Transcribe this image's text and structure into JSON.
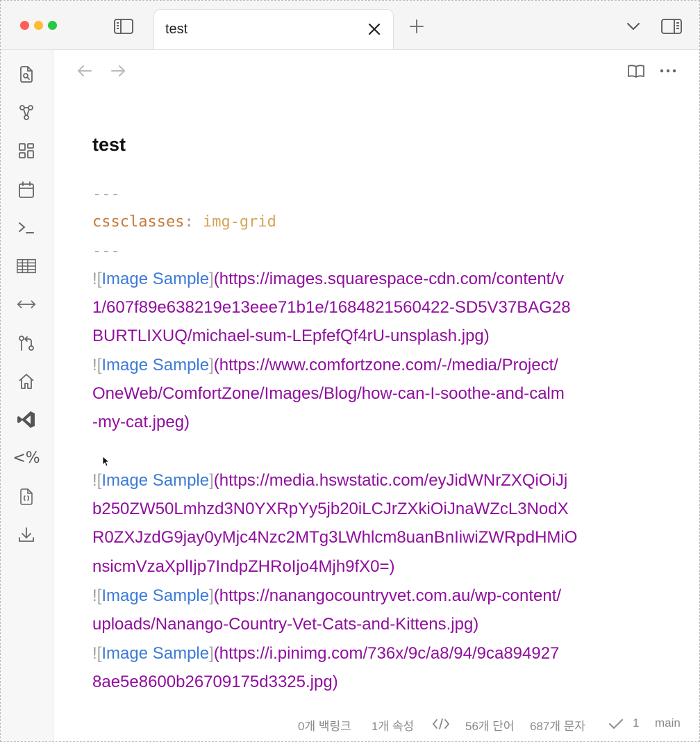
{
  "tab": {
    "title": "test"
  },
  "note": {
    "title": "test",
    "frontmatter": {
      "delimiter": "---",
      "key": "cssclasses",
      "colon": ":",
      "value": "img-grid"
    },
    "embed": {
      "bang": "!",
      "open": "[",
      "alt": "Image Sample",
      "close": "]"
    },
    "lines": [
      {
        "type": "embed",
        "url": "(https://images.squarespace-cdn.com/content/v"
      },
      {
        "type": "cont",
        "url": "1/607f89e638219e13eee71b1e/1684821560422-SD5V37BAG28"
      },
      {
        "type": "cont",
        "url": "BURTLIXUQ/michael-sum-LEpfefQf4rU-unsplash.jpg)"
      },
      {
        "type": "embed",
        "url": "(https://www.comfortzone.com/-/media/Project/"
      },
      {
        "type": "cont",
        "url": "OneWeb/ComfortZone/Images/Blog/how-can-I-soothe-and-calm"
      },
      {
        "type": "cont",
        "url": "-my-cat.jpeg)"
      },
      {
        "type": "embed",
        "url": "(https://media.hswstatic.com/eyJidWNrZXQiOiJj"
      },
      {
        "type": "cont",
        "url": "b250ZW50Lmhzd3N0YXRpYy5jb20iLCJrZXkiOiJnaWZcL3NodX"
      },
      {
        "type": "cont",
        "url": "R0ZXJzdG9jay0yMjc4Nzc2MTg3LWhlcm8uanBnIiwiZWRpdHMiO"
      },
      {
        "type": "cont",
        "url": "nsicmVzaXplIjp7IndpZHRoIjo4Mjh9fX0=)"
      },
      {
        "type": "embed",
        "url": "(https://nanangocountryvet.com.au/wp-content/"
      },
      {
        "type": "cont",
        "url": "uploads/Nanango-Country-Vet-Cats-and-Kittens.jpg)"
      },
      {
        "type": "embed",
        "url": "(https://i.pinimg.com/736x/9c/a8/94/9ca894927"
      },
      {
        "type": "cont",
        "url": "8ae5e8600b26709175d3325.jpg)"
      }
    ]
  },
  "statusbar": {
    "backlinks": "0개 백링크",
    "properties": "1개 속성",
    "words": "56개 단어",
    "characters": "687개 문자",
    "sync_count": "1",
    "branch": "main"
  },
  "icons": {
    "titlebar": [
      "sidebar-left-icon",
      "plus-icon",
      "chevron-down-icon",
      "sidebar-right-icon"
    ],
    "ribbon": [
      "search-file-icon",
      "graph-icon",
      "dashboard-icon",
      "calendar-icon",
      "terminal-icon",
      "table-icon",
      "arrows-horizontal-icon",
      "git-compare-icon",
      "home-icon",
      "vscode-icon",
      "percent-icon",
      "json-file-icon",
      "download-icon"
    ]
  },
  "colors": {
    "link_alt": "#3c7ad7",
    "url": "#900e9e",
    "fm_key": "#c57b3c",
    "fm_value": "#d8a45a"
  }
}
